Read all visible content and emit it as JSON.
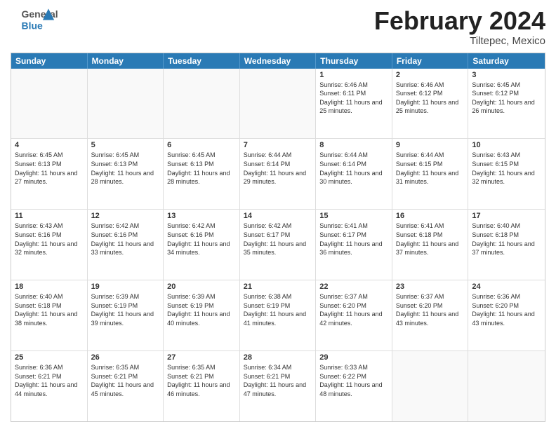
{
  "header": {
    "logo_line1": "General",
    "logo_line2": "Blue",
    "title": "February 2024",
    "location": "Tiltepec, Mexico"
  },
  "days_of_week": [
    "Sunday",
    "Monday",
    "Tuesday",
    "Wednesday",
    "Thursday",
    "Friday",
    "Saturday"
  ],
  "weeks": [
    [
      {
        "day": "",
        "info": ""
      },
      {
        "day": "",
        "info": ""
      },
      {
        "day": "",
        "info": ""
      },
      {
        "day": "",
        "info": ""
      },
      {
        "day": "1",
        "info": "Sunrise: 6:46 AM\nSunset: 6:11 PM\nDaylight: 11 hours and 25 minutes."
      },
      {
        "day": "2",
        "info": "Sunrise: 6:46 AM\nSunset: 6:12 PM\nDaylight: 11 hours and 25 minutes."
      },
      {
        "day": "3",
        "info": "Sunrise: 6:45 AM\nSunset: 6:12 PM\nDaylight: 11 hours and 26 minutes."
      }
    ],
    [
      {
        "day": "4",
        "info": "Sunrise: 6:45 AM\nSunset: 6:13 PM\nDaylight: 11 hours and 27 minutes."
      },
      {
        "day": "5",
        "info": "Sunrise: 6:45 AM\nSunset: 6:13 PM\nDaylight: 11 hours and 28 minutes."
      },
      {
        "day": "6",
        "info": "Sunrise: 6:45 AM\nSunset: 6:13 PM\nDaylight: 11 hours and 28 minutes."
      },
      {
        "day": "7",
        "info": "Sunrise: 6:44 AM\nSunset: 6:14 PM\nDaylight: 11 hours and 29 minutes."
      },
      {
        "day": "8",
        "info": "Sunrise: 6:44 AM\nSunset: 6:14 PM\nDaylight: 11 hours and 30 minutes."
      },
      {
        "day": "9",
        "info": "Sunrise: 6:44 AM\nSunset: 6:15 PM\nDaylight: 11 hours and 31 minutes."
      },
      {
        "day": "10",
        "info": "Sunrise: 6:43 AM\nSunset: 6:15 PM\nDaylight: 11 hours and 32 minutes."
      }
    ],
    [
      {
        "day": "11",
        "info": "Sunrise: 6:43 AM\nSunset: 6:16 PM\nDaylight: 11 hours and 32 minutes."
      },
      {
        "day": "12",
        "info": "Sunrise: 6:42 AM\nSunset: 6:16 PM\nDaylight: 11 hours and 33 minutes."
      },
      {
        "day": "13",
        "info": "Sunrise: 6:42 AM\nSunset: 6:16 PM\nDaylight: 11 hours and 34 minutes."
      },
      {
        "day": "14",
        "info": "Sunrise: 6:42 AM\nSunset: 6:17 PM\nDaylight: 11 hours and 35 minutes."
      },
      {
        "day": "15",
        "info": "Sunrise: 6:41 AM\nSunset: 6:17 PM\nDaylight: 11 hours and 36 minutes."
      },
      {
        "day": "16",
        "info": "Sunrise: 6:41 AM\nSunset: 6:18 PM\nDaylight: 11 hours and 37 minutes."
      },
      {
        "day": "17",
        "info": "Sunrise: 6:40 AM\nSunset: 6:18 PM\nDaylight: 11 hours and 37 minutes."
      }
    ],
    [
      {
        "day": "18",
        "info": "Sunrise: 6:40 AM\nSunset: 6:18 PM\nDaylight: 11 hours and 38 minutes."
      },
      {
        "day": "19",
        "info": "Sunrise: 6:39 AM\nSunset: 6:19 PM\nDaylight: 11 hours and 39 minutes."
      },
      {
        "day": "20",
        "info": "Sunrise: 6:39 AM\nSunset: 6:19 PM\nDaylight: 11 hours and 40 minutes."
      },
      {
        "day": "21",
        "info": "Sunrise: 6:38 AM\nSunset: 6:19 PM\nDaylight: 11 hours and 41 minutes."
      },
      {
        "day": "22",
        "info": "Sunrise: 6:37 AM\nSunset: 6:20 PM\nDaylight: 11 hours and 42 minutes."
      },
      {
        "day": "23",
        "info": "Sunrise: 6:37 AM\nSunset: 6:20 PM\nDaylight: 11 hours and 43 minutes."
      },
      {
        "day": "24",
        "info": "Sunrise: 6:36 AM\nSunset: 6:20 PM\nDaylight: 11 hours and 43 minutes."
      }
    ],
    [
      {
        "day": "25",
        "info": "Sunrise: 6:36 AM\nSunset: 6:21 PM\nDaylight: 11 hours and 44 minutes."
      },
      {
        "day": "26",
        "info": "Sunrise: 6:35 AM\nSunset: 6:21 PM\nDaylight: 11 hours and 45 minutes."
      },
      {
        "day": "27",
        "info": "Sunrise: 6:35 AM\nSunset: 6:21 PM\nDaylight: 11 hours and 46 minutes."
      },
      {
        "day": "28",
        "info": "Sunrise: 6:34 AM\nSunset: 6:21 PM\nDaylight: 11 hours and 47 minutes."
      },
      {
        "day": "29",
        "info": "Sunrise: 6:33 AM\nSunset: 6:22 PM\nDaylight: 11 hours and 48 minutes."
      },
      {
        "day": "",
        "info": ""
      },
      {
        "day": "",
        "info": ""
      }
    ]
  ]
}
